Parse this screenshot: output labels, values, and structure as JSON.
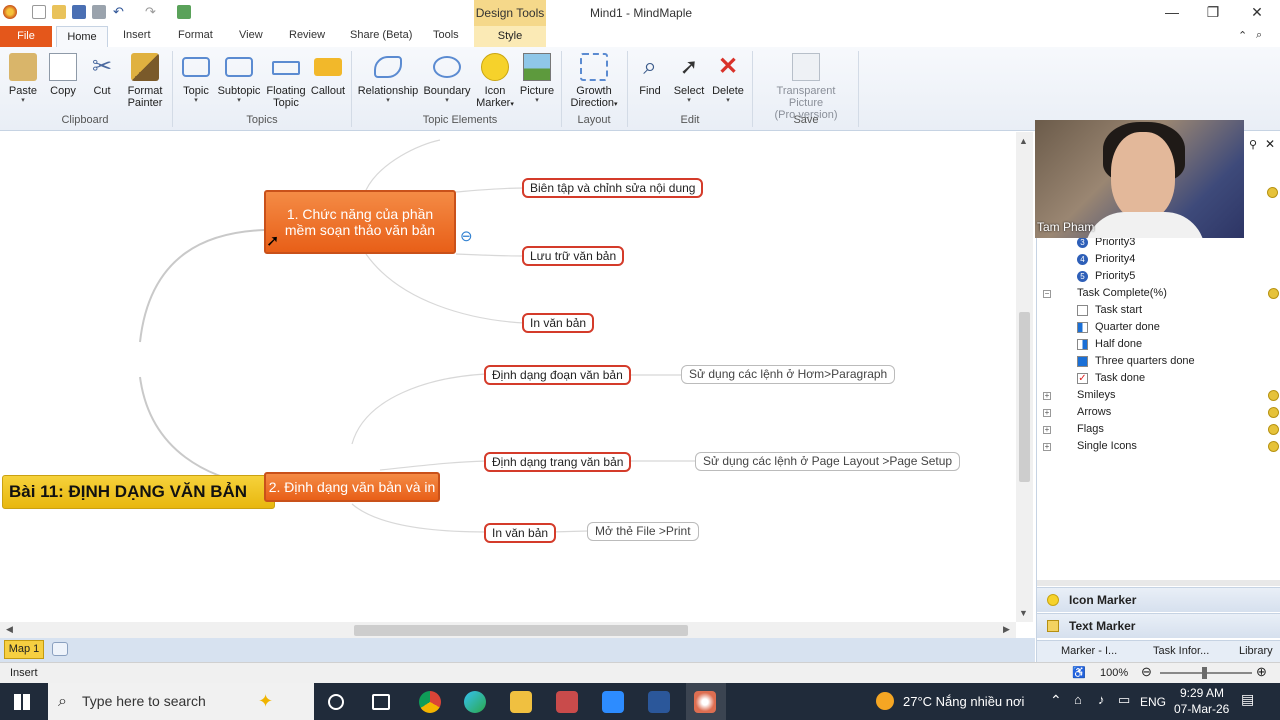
{
  "window": {
    "title": "Mind1 - MindMaple",
    "contextual_tab": "Design Tools",
    "controls": {
      "minimize": "—",
      "maximize": "❐",
      "close": "✕"
    }
  },
  "tabs": [
    "File",
    "Home",
    "Insert",
    "Format",
    "View",
    "Review",
    "Share (Beta)",
    "Tools",
    "Style"
  ],
  "ribbon": {
    "clipboard": {
      "paste": "Paste",
      "copy": "Copy",
      "cut": "Cut",
      "format_painter_1": "Format",
      "format_painter_2": "Painter",
      "group": "Clipboard"
    },
    "topics": {
      "topic": "Topic",
      "subtopic": "Subtopic",
      "floating_1": "Floating",
      "floating_2": "Topic",
      "callout": "Callout",
      "group": "Topics"
    },
    "elements": {
      "relationship": "Relationship",
      "boundary": "Boundary",
      "icon_marker_1": "Icon",
      "icon_marker_2": "Marker",
      "picture": "Picture",
      "group": "Topic Elements"
    },
    "layout": {
      "growth_1": "Growth",
      "growth_2": "Direction",
      "group": "Layout"
    },
    "edit": {
      "find": "Find",
      "select": "Select",
      "delete": "Delete",
      "group": "Edit"
    },
    "save": {
      "transparent_1": "Transparent Picture",
      "transparent_2": "(Pro version)",
      "group": "Save"
    }
  },
  "mindmap": {
    "central": "Bài 11: ĐỊNH DẠNG VĂN BẢN",
    "topic1_line1": "1. Chức năng của phần",
    "topic1_line2": "mềm soạn thảo văn bản",
    "topic2": "2. Định dạng văn bản và in",
    "sub1": "Biên tập và chỉnh sửa nội dung",
    "sub2": "Lưu trữ văn bản",
    "sub3": "In văn bản",
    "sub4": "Định dạng đoạn văn bản",
    "sub5": "Định dạng trang văn bản",
    "sub6": "In văn bản",
    "note4": "Sử dụng các lệnh ở Hơm>Paragraph",
    "note5": "Sử dụng các lệnh ở Page Layout >Page Setup",
    "note6": "Mở thẻ File >Print",
    "collapse": "⊖"
  },
  "map_tab": "Map 1",
  "status": {
    "mode": "Insert",
    "zoom": "100%"
  },
  "panel": {
    "webcam_name": "Tam Pham",
    "priorities": [
      "Priority3",
      "Priority4",
      "Priority5"
    ],
    "priority_numbers": [
      "3",
      "4",
      "5"
    ],
    "task_complete": "Task Complete(%)",
    "tasks": [
      "Task start",
      "Quarter done",
      "Half done",
      "Three quarters done",
      "Task done"
    ],
    "groups": [
      "Smileys",
      "Arrows",
      "Flags",
      "Single Icons"
    ],
    "icon_marker": "Icon Marker",
    "text_marker": "Text Marker",
    "bottom_tabs": [
      "Marker - I...",
      "Task Infor...",
      "Library"
    ]
  },
  "taskbar": {
    "search_placeholder": "Type here to search",
    "weather": "27°C  Nắng nhiều nơi",
    "lang": "ENG",
    "time": "9:29 AM",
    "date": "07-Mar-26"
  },
  "colors": {
    "file_tab": "#e4571b",
    "topic": "#e96b26",
    "central": "#f2c52a",
    "subtopic_border": "#d43b2a",
    "taskbar": "#202b3a"
  }
}
